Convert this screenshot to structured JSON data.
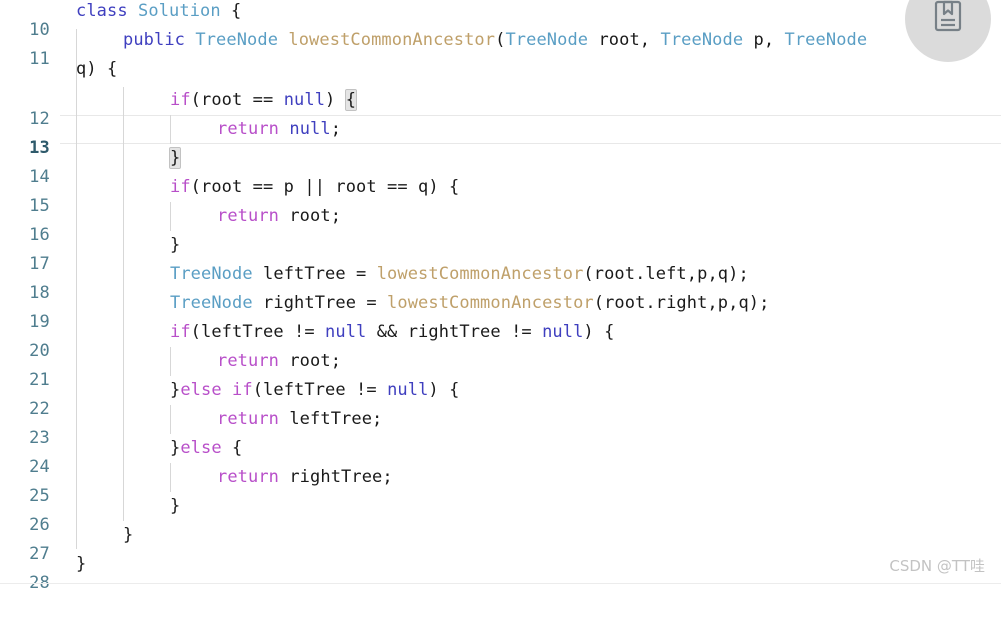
{
  "editor": {
    "language": "java",
    "first_line_number": 10,
    "active_line": 13,
    "colors": {
      "background": "#ffffff",
      "line_number": "#4f7d8e",
      "keyword": "#3f3fbf",
      "control_keyword": "#b84fc9",
      "type": "#5a9ec4",
      "function": "#bfa06a",
      "plain": "#1a1a1a",
      "indent_guide": "#d7d7d7",
      "current_line_border": "#e8e8e8",
      "brace_match_bg": "#e4e4e4"
    },
    "lines": [
      {
        "number": "10",
        "text": "class Solution {"
      },
      {
        "number": "11",
        "text": "    public TreeNode lowestCommonAncestor(TreeNode root, TreeNode p, TreeNode q) {"
      },
      {
        "number": "12",
        "text": "        if(root == null) {"
      },
      {
        "number": "13",
        "text": "            return null;"
      },
      {
        "number": "14",
        "text": "        }"
      },
      {
        "number": "15",
        "text": "        if(root == p || root == q) {"
      },
      {
        "number": "16",
        "text": "            return root;"
      },
      {
        "number": "17",
        "text": "        }"
      },
      {
        "number": "18",
        "text": "        TreeNode leftTree = lowestCommonAncestor(root.left,p,q);"
      },
      {
        "number": "19",
        "text": "        TreeNode rightTree = lowestCommonAncestor(root.right,p,q);"
      },
      {
        "number": "20",
        "text": "        if(leftTree != null && rightTree != null) {"
      },
      {
        "number": "21",
        "text": "            return root;"
      },
      {
        "number": "22",
        "text": "        }else if(leftTree != null) {"
      },
      {
        "number": "23",
        "text": "            return leftTree;"
      },
      {
        "number": "24",
        "text": "        }else {"
      },
      {
        "number": "25",
        "text": "            return rightTree;"
      },
      {
        "number": "26",
        "text": "        }"
      },
      {
        "number": "27",
        "text": "    }"
      },
      {
        "number": "28",
        "text": "}"
      }
    ],
    "tokens": {
      "l10": [
        {
          "t": "class",
          "c": "kw"
        },
        {
          "t": " ",
          "c": "pl"
        },
        {
          "t": "Solution",
          "c": "type"
        },
        {
          "t": " {",
          "c": "pl"
        }
      ],
      "l11a": [
        {
          "t": "public",
          "c": "kw"
        },
        {
          "t": " ",
          "c": "pl"
        },
        {
          "t": "TreeNode",
          "c": "type"
        },
        {
          "t": " ",
          "c": "pl"
        },
        {
          "t": "lowestCommonAncestor",
          "c": "fn"
        },
        {
          "t": "(",
          "c": "pl"
        },
        {
          "t": "TreeNode",
          "c": "type"
        },
        {
          "t": " root, ",
          "c": "pl"
        },
        {
          "t": "TreeNode",
          "c": "type"
        },
        {
          "t": " p, ",
          "c": "pl"
        },
        {
          "t": "TreeNode",
          "c": "type"
        }
      ],
      "l11b": [
        {
          "t": "q) {",
          "c": "pl"
        }
      ],
      "l12": [
        {
          "t": "if",
          "c": "ctl"
        },
        {
          "t": "(root == ",
          "c": "pl"
        },
        {
          "t": "null",
          "c": "kw"
        },
        {
          "t": ") ",
          "c": "pl"
        },
        {
          "t": "{",
          "c": "brace"
        }
      ],
      "l13": [
        {
          "t": "return",
          "c": "ctl"
        },
        {
          "t": " ",
          "c": "pl"
        },
        {
          "t": "null",
          "c": "kw"
        },
        {
          "t": ";",
          "c": "pl"
        }
      ],
      "l14": [
        {
          "t": "}",
          "c": "brace"
        }
      ],
      "l15": [
        {
          "t": "if",
          "c": "ctl"
        },
        {
          "t": "(root == p || root == q) {",
          "c": "pl"
        }
      ],
      "l16": [
        {
          "t": "return",
          "c": "ctl"
        },
        {
          "t": " root;",
          "c": "pl"
        }
      ],
      "l17": [
        {
          "t": "}",
          "c": "pl"
        }
      ],
      "l18": [
        {
          "t": "TreeNode",
          "c": "type"
        },
        {
          "t": " leftTree = ",
          "c": "pl"
        },
        {
          "t": "lowestCommonAncestor",
          "c": "fn"
        },
        {
          "t": "(root.left,p,q);",
          "c": "pl"
        }
      ],
      "l19": [
        {
          "t": "TreeNode",
          "c": "type"
        },
        {
          "t": " rightTree = ",
          "c": "pl"
        },
        {
          "t": "lowestCommonAncestor",
          "c": "fn"
        },
        {
          "t": "(root.right,p,q);",
          "c": "pl"
        }
      ],
      "l20": [
        {
          "t": "if",
          "c": "ctl"
        },
        {
          "t": "(leftTree != ",
          "c": "pl"
        },
        {
          "t": "null",
          "c": "kw"
        },
        {
          "t": " && rightTree != ",
          "c": "pl"
        },
        {
          "t": "null",
          "c": "kw"
        },
        {
          "t": ") {",
          "c": "pl"
        }
      ],
      "l21": [
        {
          "t": "return",
          "c": "ctl"
        },
        {
          "t": " root;",
          "c": "pl"
        }
      ],
      "l22": [
        {
          "t": "}",
          "c": "pl"
        },
        {
          "t": "else",
          "c": "ctl"
        },
        {
          "t": " ",
          "c": "pl"
        },
        {
          "t": "if",
          "c": "ctl"
        },
        {
          "t": "(leftTree != ",
          "c": "pl"
        },
        {
          "t": "null",
          "c": "kw"
        },
        {
          "t": ") {",
          "c": "pl"
        }
      ],
      "l23": [
        {
          "t": "return",
          "c": "ctl"
        },
        {
          "t": " leftTree;",
          "c": "pl"
        }
      ],
      "l24": [
        {
          "t": "}",
          "c": "pl"
        },
        {
          "t": "else",
          "c": "ctl"
        },
        {
          "t": " {",
          "c": "pl"
        }
      ],
      "l25": [
        {
          "t": "return",
          "c": "ctl"
        },
        {
          "t": " rightTree;",
          "c": "pl"
        }
      ],
      "l26": [
        {
          "t": "}",
          "c": "pl"
        }
      ],
      "l27": [
        {
          "t": "}",
          "c": "pl"
        }
      ],
      "l28": [
        {
          "t": "}",
          "c": "pl"
        }
      ]
    }
  },
  "overlays": {
    "bookmark_icon": "bookmark-book-icon",
    "watermark": "CSDN @TT哇"
  }
}
